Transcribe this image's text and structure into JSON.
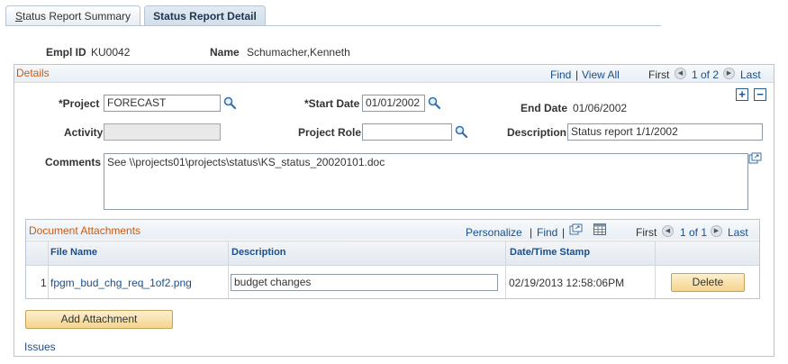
{
  "tabs": {
    "summary": {
      "first": "S",
      "rest": "tatus Report Summary"
    },
    "detail": "Status Report Detail"
  },
  "header": {
    "empl_id_label": "Empl ID",
    "empl_id_value": "KU0042",
    "name_label": "Name",
    "name_value": "Schumacher,Kenneth"
  },
  "details": {
    "title": "Details",
    "nav": {
      "find": "Find",
      "separator": "|",
      "view_all": "View All",
      "first": "First",
      "range": "1 of 2",
      "last": "Last"
    },
    "project_label": "*Project",
    "project_value": "FORECAST",
    "start_date_label": "*Start Date",
    "start_date_value": "01/01/2002",
    "end_date_label": "End Date",
    "end_date_value": "01/06/2002",
    "activity_label": "Activity",
    "activity_value": "",
    "project_role_label": "Project Role",
    "project_role_value": "",
    "description_label": "Description",
    "description_value": "Status report 1/1/2002",
    "comments_label": "Comments",
    "comments_value": "See \\\\projects01\\projects\\status\\KS_status_20020101.doc",
    "add_row": "+",
    "delete_row": "−"
  },
  "attachments": {
    "title": "Document Attachments",
    "toolbar": {
      "personalize": "Personalize",
      "separator": "|",
      "find": "Find",
      "separator2": "|",
      "first": "First",
      "range": "1 of 1",
      "last": "Last"
    },
    "columns": [
      "File Name",
      "Description",
      "Date/Time Stamp"
    ],
    "rows": [
      {
        "num": "1",
        "file_name": "fpgm_bud_chg_req_1of2.png",
        "description": "budget changes",
        "timestamp": "02/19/2013 12:58:06PM",
        "delete_label": "Delete"
      }
    ],
    "add_button": "Add Attachment"
  },
  "issues_link": "Issues",
  "colors": {
    "section_title": "#c65a15",
    "link": "#1a4f8b",
    "border": "#b8c6d3",
    "button_fill": "#f3d48c"
  }
}
